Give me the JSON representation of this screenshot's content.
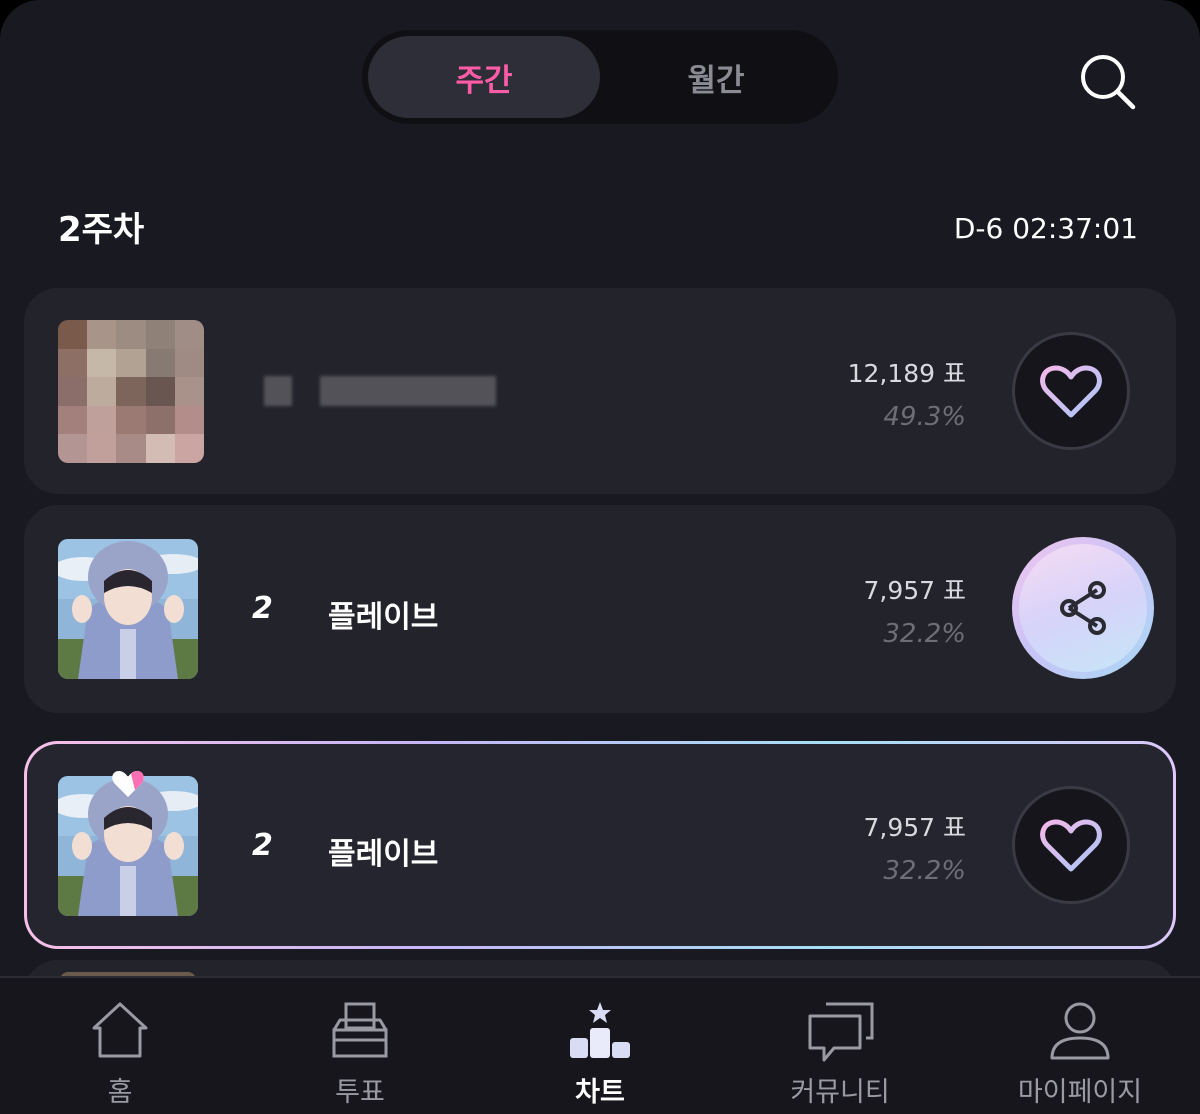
{
  "tabs": {
    "weekly": "주간",
    "monthly": "월간",
    "active": "weekly"
  },
  "header": {
    "week_label": "2주차",
    "countdown": "D-6 02:37:01"
  },
  "ranking": [
    {
      "rank": "",
      "artist": "",
      "votes": "12,189 표",
      "percent": "49.3%",
      "action": "heart-icon"
    },
    {
      "rank": "2",
      "artist": "플레이브",
      "votes": "7,957 표",
      "percent": "32.2%",
      "action": "share-icon"
    },
    {
      "rank": "2",
      "artist": "플레이브",
      "votes": "7,957 표",
      "percent": "32.2%",
      "action": "heart-icon",
      "highlighted": true
    }
  ],
  "nav": [
    {
      "label": "홈",
      "icon": "home-icon"
    },
    {
      "label": "투표",
      "icon": "ballot-box-icon"
    },
    {
      "label": "차트",
      "icon": "chart-podium-icon",
      "active": true
    },
    {
      "label": "커뮤니티",
      "icon": "chat-bubbles-icon"
    },
    {
      "label": "마이페이지",
      "icon": "user-icon"
    }
  ],
  "colors": {
    "background": "#191922",
    "accent_pink": "#ff5ca8",
    "card": "#23232c"
  }
}
